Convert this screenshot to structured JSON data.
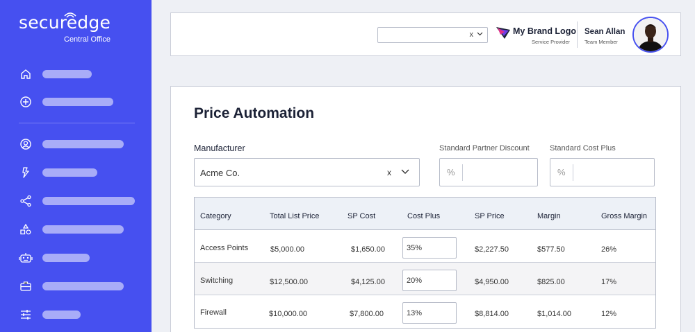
{
  "brand": {
    "logo_text": "securedge",
    "logo_sub": "Central Office",
    "accent": "#4650f0"
  },
  "sidebar": {
    "items": [
      {
        "icon": "home-icon",
        "bar_width": 71
      },
      {
        "icon": "plus-circle-icon",
        "bar_width": 102
      },
      {
        "icon": "user-circle-icon",
        "bar_width": 117
      },
      {
        "icon": "lightning-icon",
        "bar_width": 79
      },
      {
        "icon": "share-icon",
        "bar_width": 133
      },
      {
        "icon": "shapes-icon",
        "bar_width": 117
      },
      {
        "icon": "robot-icon",
        "bar_width": 68
      },
      {
        "icon": "toolbox-icon",
        "bar_width": 117
      },
      {
        "icon": "sliders-icon",
        "bar_width": 55
      }
    ]
  },
  "header": {
    "select_clear": "x",
    "brand_title": "My Brand Logo",
    "brand_sub": "Service Provider",
    "user_name": "Sean Allan",
    "user_role": "Team Member"
  },
  "main": {
    "title": "Price Automation",
    "manufacturer_label": "Manufacturer",
    "manufacturer_value": "Acme Co.",
    "manufacturer_clear": "x",
    "partner_discount_label": "Standard Partner Discount",
    "cost_plus_label": "Standard Cost Plus",
    "percent_symbol": "%"
  },
  "table": {
    "headers": [
      "Category",
      "Total List Price",
      "SP Cost",
      "Cost Plus",
      "SP Price",
      "Margin",
      "Gross Margin"
    ],
    "rows": [
      {
        "category": "Access Points",
        "list_price": "$5,000.00",
        "sp_cost": "$1,650.00",
        "cost_plus": "35%",
        "sp_price": "$2,227.50",
        "margin": "$577.50",
        "gross_margin": "26%"
      },
      {
        "category": "Switching",
        "list_price": "$12,500.00",
        "sp_cost": "$4,125.00",
        "cost_plus": "20%",
        "sp_price": "$4,950.00",
        "margin": "$825.00",
        "gross_margin": "17%"
      },
      {
        "category": "Firewall",
        "list_price": "$10,000.00",
        "sp_cost": "$7,800.00",
        "cost_plus": "13%",
        "sp_price": "$8,814.00",
        "margin": "$1,014.00",
        "gross_margin": "12%"
      }
    ]
  }
}
